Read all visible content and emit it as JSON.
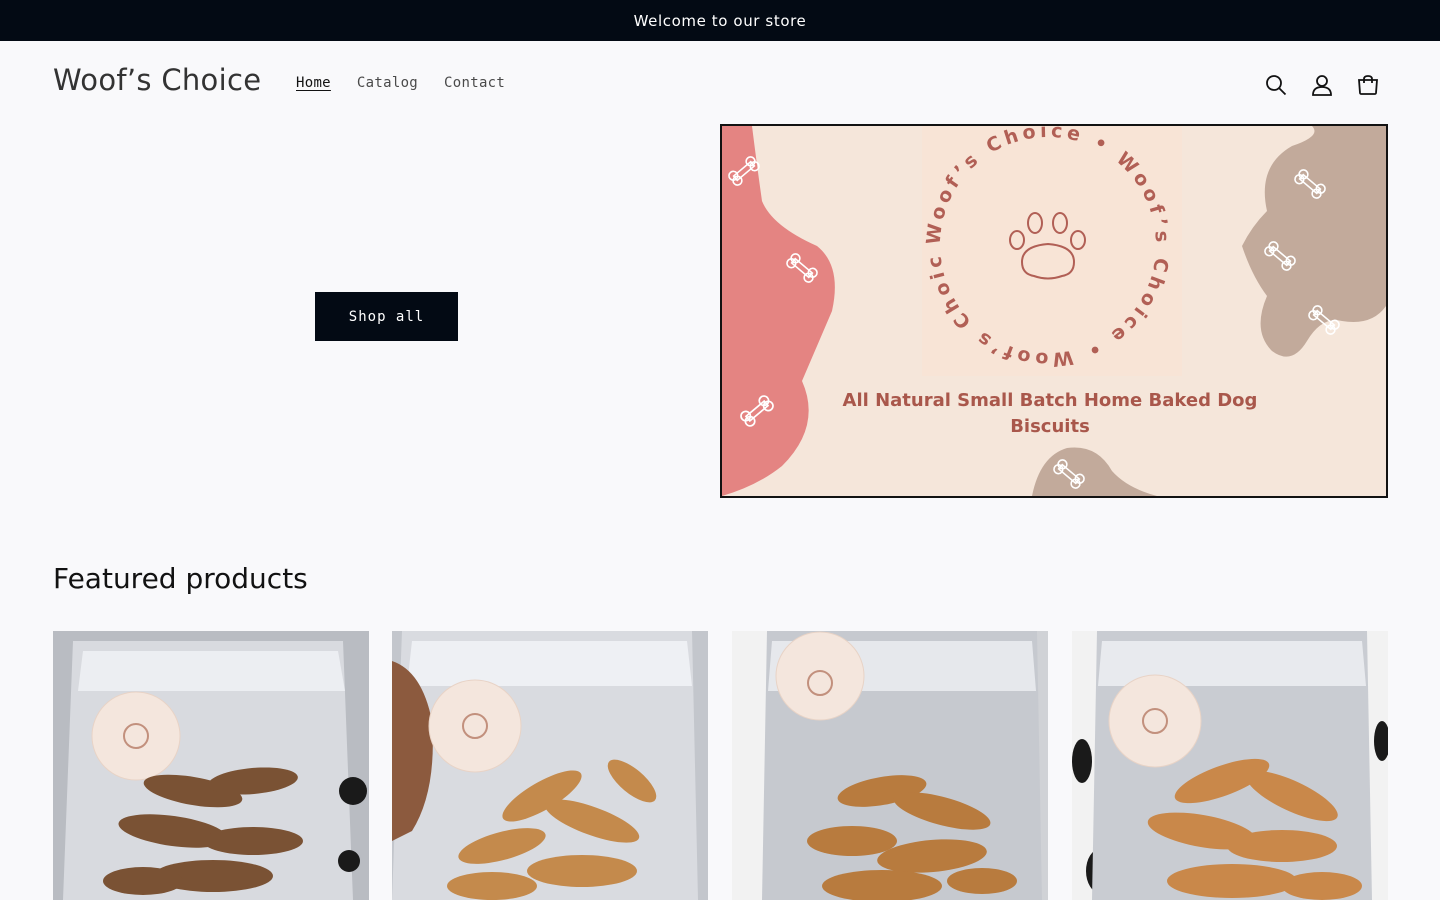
{
  "announcement": {
    "text": "Welcome to our store"
  },
  "header": {
    "logo": "Woof’s Choice",
    "nav": [
      {
        "label": "Home",
        "active": true
      },
      {
        "label": "Catalog",
        "active": false
      },
      {
        "label": "Contact",
        "active": false
      }
    ],
    "icons": [
      "search-icon",
      "account-icon",
      "cart-icon"
    ]
  },
  "hero": {
    "button_label": "Shop all",
    "image": {
      "ring_text": "Woof’s Choice • Woof’s Choice • Woof’s Choice •",
      "tagline_line1": "All Natural Small Batch Home Baked Dog",
      "tagline_line2": "Biscuits"
    }
  },
  "featured": {
    "title": "Featured products",
    "products": [
      {
        "name": "product-1",
        "biscuit_color": "#7a5234"
      },
      {
        "name": "product-2",
        "biscuit_color": "#c48a4c"
      },
      {
        "name": "product-3",
        "biscuit_color": "#b87b3e"
      },
      {
        "name": "product-4",
        "biscuit_color": "#c9884a"
      }
    ]
  },
  "colors": {
    "announcement_bg": "#030a14",
    "button_bg": "#030a14",
    "hero_bg": "#f5e6da",
    "accent_pink": "#e48482",
    "accent_taupe": "#c2aa9b",
    "brand_text": "#a9574b"
  }
}
